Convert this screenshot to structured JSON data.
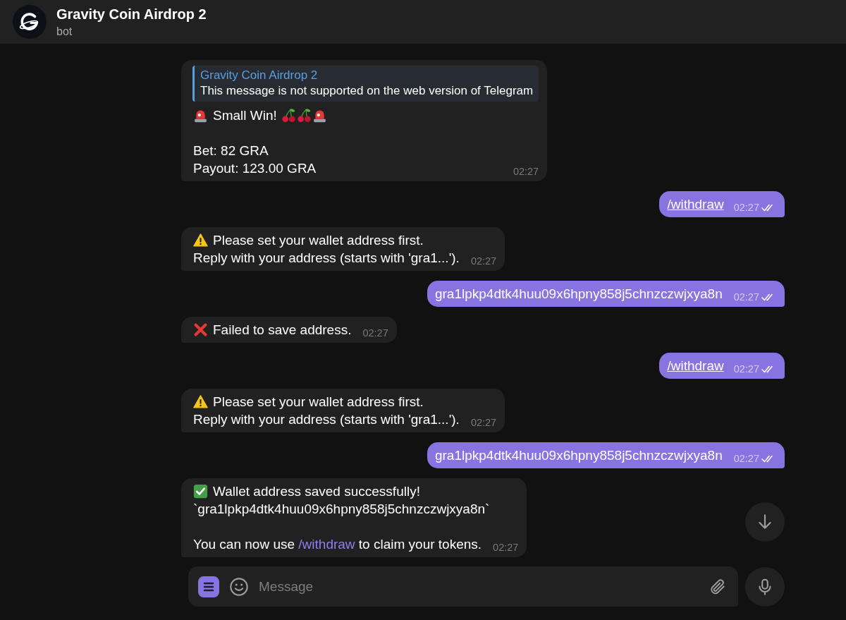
{
  "header": {
    "title": "Gravity Coin Airdrop 2",
    "subtitle": "bot"
  },
  "messages": [
    {
      "kind": "incoming",
      "quote": {
        "author": "Gravity Coin Airdrop 2",
        "text": "This message is not supported on the web version of Telegram"
      },
      "paragraphs": [
        [
          [
            {
              "kind": "siren"
            },
            {
              "kind": "text",
              "text": "Small Win!"
            },
            {
              "kind": "cherries"
            },
            {
              "kind": "cherries"
            },
            {
              "kind": "siren"
            }
          ]
        ],
        [
          [
            {
              "kind": "text",
              "text": "Bet: 82 GRA"
            }
          ],
          [
            {
              "kind": "text",
              "text": "Payout: 123.00 GRA"
            }
          ]
        ]
      ],
      "time": "02:27"
    },
    {
      "kind": "outgoing",
      "paragraphs": [
        [
          [
            {
              "kind": "command",
              "text": "/withdraw"
            }
          ]
        ]
      ],
      "time": "02:27",
      "read": true
    },
    {
      "kind": "incoming",
      "paragraphs": [
        [
          [
            {
              "kind": "warning"
            },
            {
              "kind": "text",
              "text": "Please set your wallet address first."
            }
          ],
          [
            {
              "kind": "text",
              "text": "Reply with your address (starts with 'gra1...')."
            }
          ]
        ]
      ],
      "time": "02:27"
    },
    {
      "kind": "outgoing",
      "paragraphs": [
        [
          [
            {
              "kind": "text",
              "text": "gra1lpkp4dtk4huu09x6hpny858j5chnzczwjxya8n"
            }
          ]
        ]
      ],
      "time": "02:27",
      "read": true
    },
    {
      "kind": "incoming",
      "paragraphs": [
        [
          [
            {
              "kind": "cross"
            },
            {
              "kind": "text",
              "text": "Failed to save address."
            }
          ]
        ]
      ],
      "time": "02:27"
    },
    {
      "kind": "outgoing",
      "paragraphs": [
        [
          [
            {
              "kind": "command",
              "text": "/withdraw"
            }
          ]
        ]
      ],
      "time": "02:27",
      "read": true
    },
    {
      "kind": "incoming",
      "paragraphs": [
        [
          [
            {
              "kind": "warning"
            },
            {
              "kind": "text",
              "text": "Please set your wallet address first."
            }
          ],
          [
            {
              "kind": "text",
              "text": "Reply with your address (starts with 'gra1...')."
            }
          ]
        ]
      ],
      "time": "02:27"
    },
    {
      "kind": "outgoing",
      "paragraphs": [
        [
          [
            {
              "kind": "text",
              "text": "gra1lpkp4dtk4huu09x6hpny858j5chnzczwjxya8n"
            }
          ]
        ]
      ],
      "time": "02:27",
      "read": true
    },
    {
      "kind": "incoming",
      "paragraphs": [
        [
          [
            {
              "kind": "check"
            },
            {
              "kind": "text",
              "text": "Wallet address saved successfully!"
            }
          ],
          [
            {
              "kind": "text",
              "text": "`gra1lpkp4dtk4huu09x6hpny858j5chnzczwjxya8n`"
            }
          ]
        ],
        [
          [
            {
              "kind": "text",
              "text": "You can now use"
            },
            {
              "kind": "command",
              "text": "/withdraw"
            },
            {
              "kind": "text",
              "text": "to claim your tokens."
            }
          ]
        ]
      ],
      "time": "02:27"
    }
  ],
  "composer": {
    "placeholder": "Message"
  }
}
